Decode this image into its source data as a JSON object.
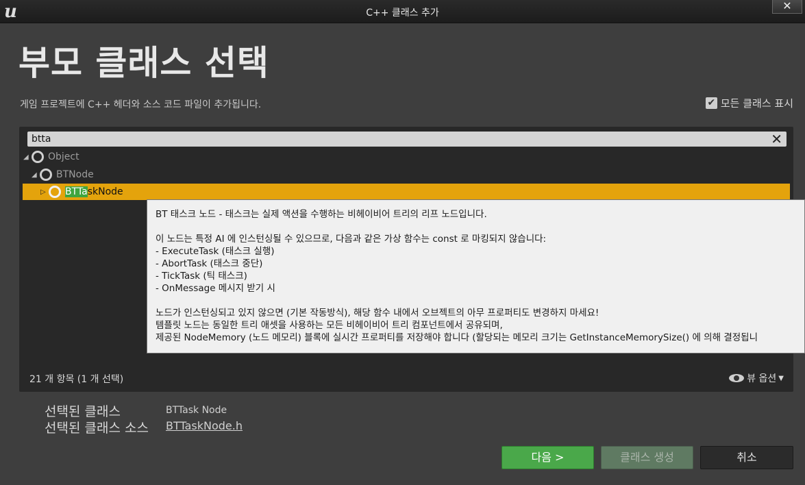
{
  "window": {
    "title": "C++ 클래스 추가",
    "logo_text": "u",
    "close_glyph": "✕"
  },
  "header": {
    "title": "부모 클래스 선택",
    "description": "게임 프로젝트에 C++ 헤더와 소스 코드 파일이 추가됩니다.",
    "show_all_label": "모든 클래스 표시",
    "show_all_checked": true
  },
  "search": {
    "value": "btta",
    "clear_glyph": "✕"
  },
  "tree": [
    {
      "label": "Object",
      "expanded": true
    },
    {
      "label": "BTNode",
      "expanded": true
    },
    {
      "label_highlight": "BTTa",
      "label_rest": "skNode",
      "selected": true,
      "expanded": false
    }
  ],
  "tooltip": {
    "line1": "BT 태스크 노드 - 태스크는 실제 액션을 수행하는 비헤이비어 트리의 리프 노드입니다.",
    "line2": "이 노드는 특정 AI 에 인스턴싱될 수 있으므로, 다음과 같은 가상 함수는 const 로 마킹되지 않습니다:",
    "line3": " - ExecuteTask (태스크 실행)",
    "line4": " - AbortTask (태스크 중단)",
    "line5": " - TickTask (틱 태스크)",
    "line6": " - OnMessage 메시지 받기 시",
    "line7": "노드가 인스턴싱되고 있지 않으면 (기본 작동방식), 해당 함수 내에서 오브젝트의 아무 프로퍼티도 변경하지 마세요!",
    "line8": "템플릿 노드는 동일한 트리 애셋을 사용하는 모든 비헤이비어 트리 컴포넌트에서 공유되며,",
    "line9": "제공된 NodeMemory (노드 메모리) 블록에 실시간 프로퍼티를 저장해야 합니다 (할당되는 메모리 크기는 GetInstanceMemorySize() 에 의해 결정됩니"
  },
  "footer": {
    "count": "21 개 항목 (1 개 선택)",
    "view_options": "뷰 옵션"
  },
  "selection": {
    "class_label": "선택된 클래스",
    "class_value": "BTTask Node",
    "source_label": "선택된 클래스 소스",
    "source_value": "BTTaskNode.h"
  },
  "buttons": {
    "next": "다음 >",
    "create": "클래스 생성",
    "cancel": "취소"
  },
  "colors": {
    "accent_selected": "#e4a30c",
    "highlight": "#3fa53f",
    "primary_button": "#4aa84a"
  }
}
